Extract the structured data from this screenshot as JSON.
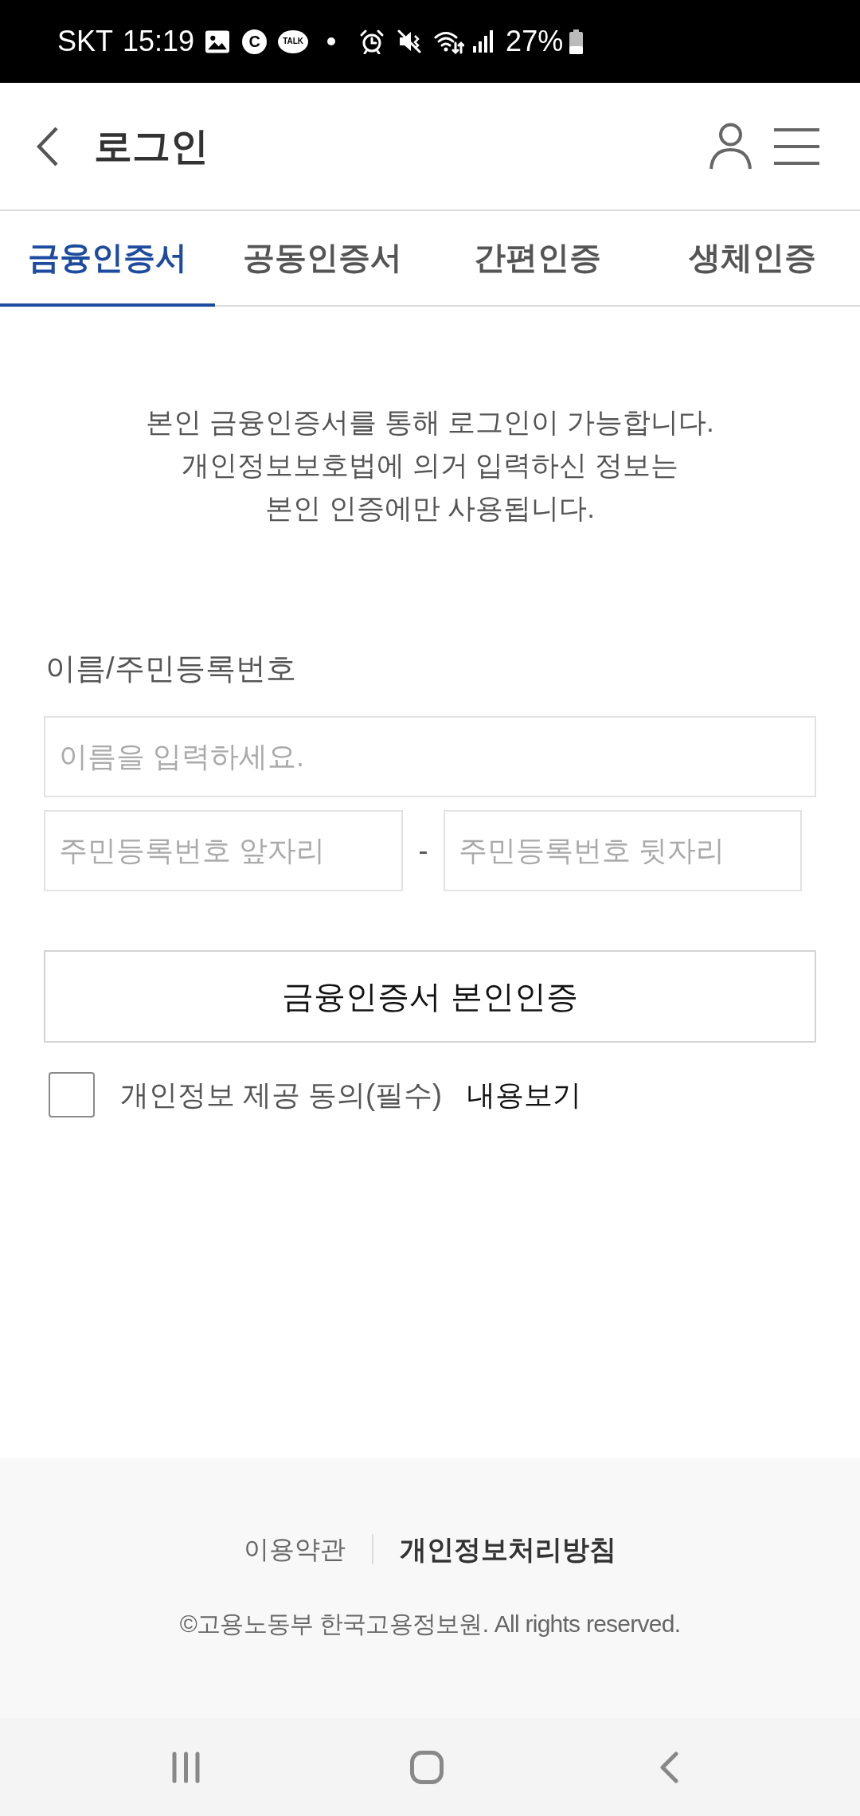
{
  "status_bar": {
    "carrier": "SKT",
    "time": "15:19",
    "badge": "C",
    "chat": "TALK",
    "battery": "27%"
  },
  "header": {
    "title": "로그인"
  },
  "tabs": [
    {
      "label": "금융인증서",
      "selected": true
    },
    {
      "label": "공동인증서",
      "selected": false
    },
    {
      "label": "간편인증",
      "selected": false
    },
    {
      "label": "생체인증",
      "selected": false
    }
  ],
  "notice": [
    "본인 금융인증서를 통해 로그인이 가능합니다.",
    "개인정보보호법에 의거 입력하신 정보는",
    "본인 인증에만 사용됩니다."
  ],
  "form": {
    "label": "이름/주민등록번호",
    "name_field": {
      "placeholder": "이름을 입력하세요."
    },
    "id_front": {
      "placeholder": "주민등록번호 앞자리"
    },
    "separator": "-",
    "id_back": {
      "placeholder": "주민등록번호 뒷자리"
    },
    "submit": "금융인증서 본인인증",
    "consent": {
      "checked": false,
      "label": "개인정보 제공 동의(필수)",
      "link": "내용보기"
    }
  },
  "footer": {
    "links": [
      {
        "label": "이용약관",
        "emphasized": false
      },
      {
        "label": "개인정보처리방침",
        "emphasized": true
      }
    ],
    "copyright": "©고용노동부 한국고용정보원. All rights reserved."
  }
}
